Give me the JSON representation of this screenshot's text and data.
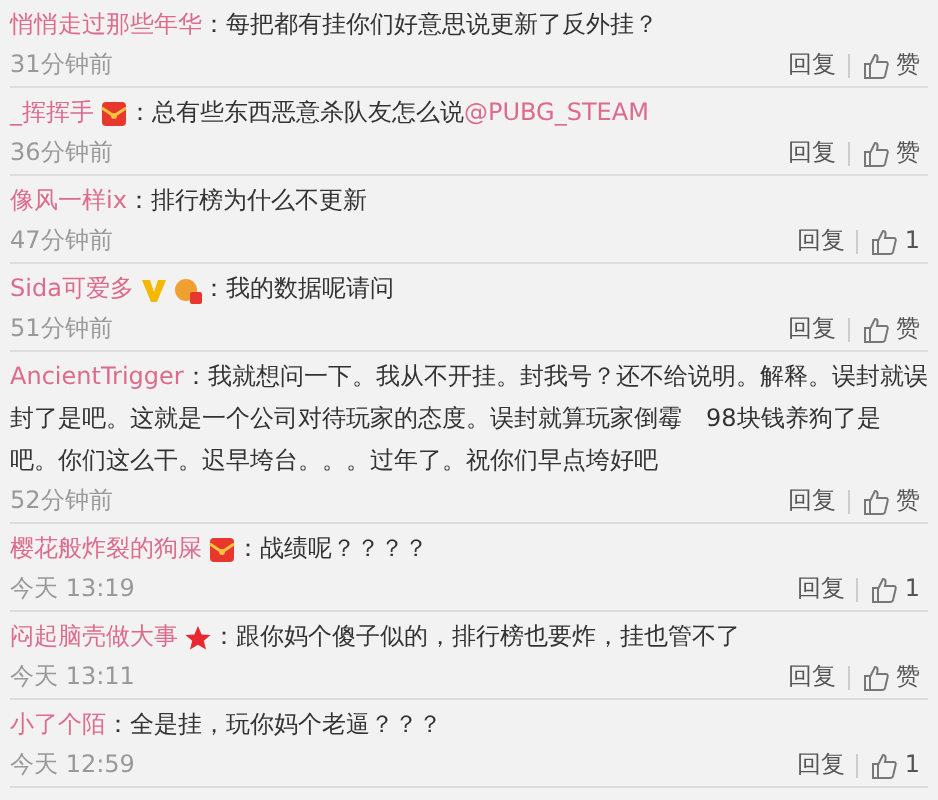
{
  "comments": [
    {
      "user": "悄悄走过那些年华",
      "text": "：每把都有挂你们好意思说更新了反外挂？",
      "time": "31分钟前",
      "reply": "回复",
      "like": "赞"
    },
    {
      "user": "_挥挥手",
      "badges": [
        {
          "kind": "redpacket"
        }
      ],
      "text": "：总有些东西恶意杀队友怎么说",
      "mention": "@PUBG_STEAM",
      "time": "36分钟前",
      "reply": "回复",
      "like": "赞"
    },
    {
      "user": "像风一样ix",
      "text": "：排行榜为什么不更新",
      "time": "47分钟前",
      "reply": "回复",
      "like": "1"
    },
    {
      "user": "Sida可爱多",
      "badges": [
        {
          "kind": "verified"
        },
        {
          "kind": "avatar"
        }
      ],
      "text": "：我的数据呢请问",
      "time": "51分钟前",
      "reply": "回复",
      "like": "赞"
    },
    {
      "user": "AncientTrigger",
      "text": "：我就想问一下。我从不开挂。封我号？还不给说明。解释。误封就误封了是吧。这就是一个公司对待玩家的态度。误封就算玩家倒霉　98块钱养狗了是吧。你们这么干。迟早垮台。。。过年了。祝你们早点垮好吧",
      "time": "52分钟前",
      "reply": "回复",
      "like": "赞"
    },
    {
      "user": "樱花般炸裂的狗屎",
      "badges": [
        {
          "kind": "redpacket"
        }
      ],
      "text": "：战绩呢？？？？",
      "time": "今天 13:19",
      "reply": "回复",
      "like": "1"
    },
    {
      "user": "闷起脑壳做大事",
      "badges": [
        {
          "kind": "star"
        }
      ],
      "text": "：跟你妈个傻子似的，排行榜也要炸，挂也管不了",
      "time": "今天 13:11",
      "reply": "回复",
      "like": "赞"
    },
    {
      "user": "小了个陌",
      "text": "：全是挂，玩你妈个老逼？？？",
      "time": "今天 12:59",
      "reply": "回复",
      "like": "1"
    }
  ]
}
